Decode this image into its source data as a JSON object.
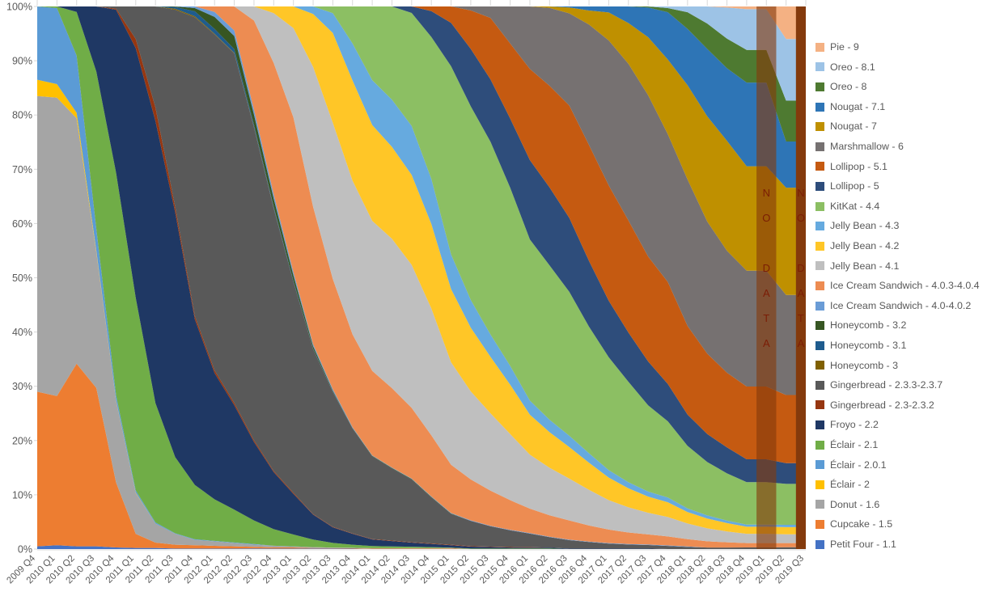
{
  "chart_data": {
    "type": "area",
    "title": "",
    "xlabel": "",
    "ylabel": "",
    "ylim": [
      0,
      100
    ],
    "y_ticks": [
      "0%",
      "10%",
      "20%",
      "30%",
      "40%",
      "50%",
      "60%",
      "70%",
      "80%",
      "90%",
      "100%"
    ],
    "stacking": "percent",
    "grid": false,
    "legend_position": "right",
    "categories": [
      "2009 Q4",
      "2010 Q1",
      "2010 Q2",
      "2010 Q3",
      "2010 Q4",
      "2011 Q1",
      "2011 Q2",
      "2011 Q3",
      "2011 Q4",
      "2012 Q1",
      "2012 Q2",
      "2012 Q3",
      "2012 Q4",
      "2013 Q1",
      "2013 Q2",
      "2013 Q3",
      "2013 Q4",
      "2014 Q1",
      "2014 Q2",
      "2014 Q3",
      "2014 Q4",
      "2015 Q1",
      "2015 Q2",
      "2015 Q3",
      "2015 Q4",
      "2016 Q1",
      "2016 Q2",
      "2016 Q3",
      "2016 Q4",
      "2017 Q1",
      "2017 Q2",
      "2017 Q3",
      "2017 Q4",
      "2018 Q1",
      "2018 Q2",
      "2018 Q3",
      "2018 Q4",
      "2019 Q1",
      "2019 Q2",
      "2019 Q3"
    ],
    "no_data_columns": [
      "2019 Q1",
      "2019 Q3"
    ],
    "no_data_label": "NO DATA",
    "no_data_color": "#843A0C",
    "series": [
      {
        "name": "Pie - 9",
        "color": "#F4B183",
        "values": [
          0,
          0,
          0,
          0,
          0,
          0,
          0,
          0,
          0,
          0,
          0,
          0,
          0,
          0,
          0,
          0,
          0,
          0,
          0,
          0,
          0,
          0,
          0,
          0,
          0,
          0,
          0,
          0,
          0,
          0,
          0,
          0,
          0,
          0,
          0,
          0.2,
          0.5,
          0,
          5.5,
          0
        ]
      },
      {
        "name": "Oreo - 8.1",
        "color": "#9DC3E6",
        "values": [
          0,
          0,
          0,
          0,
          0,
          0,
          0,
          0,
          0,
          0,
          0,
          0,
          0,
          0,
          0,
          0,
          0,
          0,
          0,
          0,
          0,
          0,
          0,
          0,
          0,
          0,
          0,
          0,
          0,
          0,
          0,
          0,
          0.3,
          1.1,
          3.3,
          6.0,
          7.5,
          0,
          10.4,
          0
        ]
      },
      {
        "name": "Oreo - 8",
        "color": "#4E7A31",
        "values": [
          0,
          0,
          0,
          0,
          0,
          0,
          0,
          0,
          0,
          0,
          0,
          0,
          0,
          0,
          0,
          0,
          0,
          0,
          0,
          0,
          0,
          0,
          0,
          0,
          0,
          0,
          0,
          0,
          0,
          0,
          0,
          0.2,
          0.8,
          3.2,
          4.9,
          5.7,
          6.0,
          0,
          6.9,
          0
        ]
      },
      {
        "name": "Nougat - 7.1",
        "color": "#2E75B6",
        "values": [
          0,
          0,
          0,
          0,
          0,
          0,
          0,
          0,
          0,
          0,
          0,
          0,
          0,
          0,
          0,
          0,
          0,
          0,
          0,
          0,
          0,
          0,
          0,
          0,
          0,
          0,
          0,
          0.2,
          0.8,
          1.2,
          3.3,
          5.9,
          9.0,
          10.8,
          13.0,
          14.0,
          15.4,
          0,
          7.8,
          0
        ]
      },
      {
        "name": "Nougat - 7",
        "color": "#BF9000",
        "values": [
          0,
          0,
          0,
          0,
          0,
          0,
          0,
          0,
          0,
          0,
          0,
          0,
          0,
          0,
          0,
          0,
          0,
          0,
          0,
          0,
          0,
          0,
          0,
          0,
          0,
          0,
          0.3,
          1.2,
          2.8,
          5.6,
          8.1,
          11.5,
          14.2,
          18.1,
          20.3,
          21.2,
          19.2,
          0,
          18.1,
          0
        ]
      },
      {
        "name": "Marshmallow - 6",
        "color": "#767171",
        "values": [
          0,
          0,
          0,
          0,
          0,
          0,
          0,
          0,
          0,
          0,
          0,
          0,
          0,
          0,
          0,
          0,
          0,
          0,
          0,
          0,
          0,
          0,
          0.8,
          2.3,
          7.5,
          13.3,
          16.4,
          18.7,
          24.0,
          29.0,
          31.2,
          32.0,
          28.1,
          28.1,
          25.5,
          23.5,
          21.3,
          0,
          16.9,
          0
        ]
      },
      {
        "name": "Lollipop - 5.1",
        "color": "#C55A11",
        "values": [
          0,
          0,
          0,
          0,
          0,
          0,
          0,
          0,
          0,
          0,
          0,
          0,
          0,
          0,
          0,
          0,
          0,
          0,
          0,
          0,
          1.0,
          3.4,
          7.8,
          12.4,
          15.2,
          19.4,
          21.4,
          22.8,
          23.1,
          23.1,
          22.3,
          20.8,
          19.4,
          17.0,
          15.5,
          14.4,
          13.4,
          0,
          11.5,
          0
        ]
      },
      {
        "name": "Lollipop - 5",
        "color": "#2E4D7B",
        "values": [
          0,
          0,
          0,
          0,
          0,
          0,
          0,
          0,
          0,
          0,
          0,
          0,
          0,
          0,
          0,
          0,
          0,
          0,
          0,
          1.4,
          5.5,
          9.0,
          11.6,
          12.6,
          14.0,
          16.9,
          16.4,
          15.0,
          13.1,
          11.3,
          9.8,
          8.7,
          7.1,
          6.0,
          5.4,
          5.0,
          4.2,
          0,
          3.5,
          0
        ]
      },
      {
        "name": "KitKat - 4.4",
        "color": "#8CBF63",
        "values": [
          0,
          0,
          0,
          0,
          0,
          0,
          0,
          0,
          0,
          0,
          0,
          0,
          0,
          0,
          0,
          1.4,
          8.5,
          16.9,
          20.9,
          24.5,
          30.2,
          39.1,
          39.2,
          38.9,
          36.1,
          34.3,
          32.5,
          29.2,
          25.2,
          22.6,
          20.0,
          17.1,
          14.5,
          12.0,
          10.3,
          9.1,
          7.8,
          0,
          6.9,
          0
        ]
      },
      {
        "name": "Jelly Bean - 4.3",
        "color": "#66AADF",
        "values": [
          0,
          0,
          0,
          0,
          0,
          0,
          0,
          0,
          0,
          0,
          0,
          0,
          0,
          0,
          1.5,
          4.2,
          8.5,
          10.3,
          10.6,
          10.6,
          9.6,
          7.2,
          5.6,
          4.5,
          3.8,
          3.0,
          2.6,
          2.3,
          1.9,
          1.5,
          1.2,
          1.0,
          0.9,
          0.7,
          0.6,
          0.5,
          0.4,
          0,
          0.4,
          0
        ]
      },
      {
        "name": "Jelly Bean - 4.2",
        "color": "#FFC627",
        "values": [
          0,
          0,
          0,
          0,
          0,
          0,
          0,
          0,
          0,
          0,
          0,
          0,
          1.2,
          4.0,
          10.6,
          19.0,
          23.0,
          22.0,
          20.6,
          19.5,
          18.0,
          15.2,
          12.9,
          11.4,
          10.0,
          8.5,
          7.5,
          6.4,
          5.4,
          4.5,
          3.8,
          3.2,
          2.8,
          2.2,
          1.9,
          1.6,
          1.3,
          0,
          1.2,
          0
        ]
      },
      {
        "name": "Jelly Bean - 4.1",
        "color": "#BFBFBF",
        "values": [
          0,
          0,
          0,
          0,
          0,
          0,
          0,
          0,
          0,
          0,
          0,
          2.5,
          9.0,
          16.5,
          28.0,
          33.0,
          35.3,
          34.4,
          33.5,
          31.0,
          27.0,
          21.3,
          17.8,
          15.6,
          13.4,
          11.5,
          10.0,
          8.5,
          7.1,
          5.9,
          5.0,
          4.3,
          3.7,
          3.0,
          2.5,
          2.1,
          1.7,
          0,
          1.5,
          0
        ]
      },
      {
        "name": "Ice Cream Sandwich - 4.0.3-4.0.4",
        "color": "#ED8C52",
        "values": [
          0,
          0,
          0,
          0,
          0,
          0,
          0,
          0,
          0,
          1.0,
          4.4,
          15.9,
          23.7,
          28.6,
          27.5,
          23.3,
          21.3,
          19.4,
          17.8,
          15.3,
          13.0,
          10.0,
          8.3,
          7.1,
          6.0,
          5.2,
          4.5,
          3.9,
          3.2,
          2.7,
          2.3,
          2.0,
          1.7,
          1.4,
          1.2,
          1.0,
          0.8,
          0,
          0.7,
          0
        ]
      },
      {
        "name": "Ice Cream Sandwich - 4.0-4.0.2",
        "color": "#6A9CD6",
        "values": [
          0,
          0,
          0,
          0,
          0,
          0,
          0,
          0,
          0.3,
          0.9,
          1.0,
          0.9,
          0.8,
          0.6,
          0.4,
          0.3,
          0.2,
          0.1,
          0.1,
          0.1,
          0.1,
          0.1,
          0.1,
          0.1,
          0.1,
          0.1,
          0.1,
          0.1,
          0.1,
          0.1,
          0.1,
          0.1,
          0.1,
          0.1,
          0,
          0,
          0,
          0,
          0,
          0
        ]
      },
      {
        "name": "Honeycomb - 3.2",
        "color": "#375623",
        "values": [
          0,
          0,
          0,
          0,
          0,
          0,
          0,
          0.1,
          0.6,
          2.2,
          2.4,
          1.8,
          1.4,
          1.0,
          0.5,
          0.2,
          0.1,
          0.1,
          0.1,
          0.1,
          0.1,
          0.1,
          0,
          0,
          0,
          0,
          0,
          0,
          0,
          0,
          0,
          0,
          0,
          0,
          0,
          0,
          0,
          0,
          0,
          0
        ]
      },
      {
        "name": "Honeycomb - 3.1",
        "color": "#1F5C8E",
        "values": [
          0,
          0,
          0,
          0,
          0,
          0,
          0,
          0.3,
          0.9,
          0.9,
          0.7,
          0.4,
          0.3,
          0.2,
          0.1,
          0.1,
          0,
          0,
          0,
          0,
          0,
          0,
          0,
          0,
          0,
          0,
          0,
          0,
          0,
          0,
          0,
          0,
          0,
          0,
          0,
          0,
          0,
          0,
          0,
          0
        ]
      },
      {
        "name": "Honeycomb - 3",
        "color": "#806000",
        "values": [
          0,
          0,
          0,
          0,
          0,
          0,
          0,
          0.2,
          0.2,
          0.1,
          0.1,
          0.1,
          0.1,
          0,
          0,
          0,
          0,
          0,
          0,
          0,
          0,
          0,
          0,
          0,
          0,
          0,
          0,
          0,
          0,
          0,
          0,
          0,
          0,
          0,
          0,
          0,
          0,
          0,
          0,
          0
        ]
      },
      {
        "name": "Gingerbread - 2.3.3-2.3.7",
        "color": "#595959",
        "values": [
          0,
          0,
          0,
          0,
          0.4,
          6.0,
          18.6,
          36.2,
          55.0,
          61.5,
          63.9,
          55.8,
          47.4,
          39.0,
          33.0,
          28.5,
          24.1,
          19.0,
          16.2,
          13.6,
          9.8,
          6.4,
          5.1,
          4.1,
          3.4,
          2.9,
          2.2,
          1.7,
          1.3,
          1.0,
          0.8,
          0.7,
          0.6,
          0.4,
          0.3,
          0.3,
          0.3,
          0,
          0.3,
          0
        ]
      },
      {
        "name": "Gingerbread - 2.3-2.3.2",
        "color": "#963610",
        "values": [
          0,
          0,
          0,
          0,
          0.2,
          1.7,
          2.5,
          1.0,
          0.6,
          0.5,
          0.4,
          0.3,
          0.2,
          0.2,
          0.1,
          0.1,
          0.1,
          0.1,
          0.1,
          0.1,
          0.1,
          0.1,
          0.1,
          0.1,
          0.1,
          0.1,
          0,
          0,
          0,
          0,
          0,
          0,
          0,
          0,
          0,
          0,
          0,
          0,
          0,
          0
        ]
      },
      {
        "name": "Froyo - 2.2",
        "color": "#1F3864",
        "values": [
          0,
          0,
          1.0,
          12.0,
          30.0,
          46.0,
          52.0,
          45.0,
          30.5,
          23.1,
          19.1,
          14.0,
          10.3,
          7.5,
          5.0,
          3.3,
          2.5,
          1.5,
          1.2,
          0.9,
          0.7,
          0.5,
          0.4,
          0.3,
          0.2,
          0.2,
          0.2,
          0.1,
          0.1,
          0.1,
          0.1,
          0.1,
          0,
          0,
          0,
          0,
          0,
          0,
          0,
          0
        ]
      },
      {
        "name": "Éclair - 2.1",
        "color": "#70AD47",
        "values": [
          0,
          0.3,
          8.0,
          29.0,
          41.0,
          35.5,
          22.0,
          14.0,
          10.0,
          7.6,
          6.0,
          4.2,
          3.0,
          2.2,
          1.5,
          1.0,
          0.7,
          0.5,
          0.4,
          0.3,
          0.2,
          0.1,
          0.1,
          0.1,
          0.1,
          0.1,
          0.1,
          0,
          0,
          0,
          0,
          0,
          0,
          0,
          0,
          0,
          0,
          0,
          0,
          0
        ]
      },
      {
        "name": "Éclair - 2.0.1",
        "color": "#5B9BD5",
        "values": [
          13.5,
          14.0,
          10.5,
          4.0,
          1.0,
          0.4,
          0.2,
          0.1,
          0.1,
          0.1,
          0.1,
          0.1,
          0,
          0,
          0,
          0,
          0,
          0,
          0,
          0,
          0,
          0,
          0,
          0,
          0,
          0,
          0,
          0,
          0,
          0,
          0,
          0,
          0,
          0,
          0,
          0,
          0,
          0,
          0,
          0
        ]
      },
      {
        "name": "Éclair - 2",
        "color": "#FFC000",
        "values": [
          3.0,
          2.5,
          1.0,
          0.3,
          0.1,
          0.1,
          0,
          0,
          0,
          0,
          0,
          0,
          0,
          0,
          0,
          0,
          0,
          0,
          0,
          0,
          0,
          0,
          0,
          0,
          0,
          0,
          0,
          0,
          0,
          0,
          0,
          0,
          0,
          0,
          0,
          0,
          0,
          0,
          0,
          0
        ]
      },
      {
        "name": "Donut - 1.6",
        "color": "#A5A5A5",
        "values": [
          54.5,
          55.0,
          45.0,
          25.0,
          15.0,
          7.5,
          3.5,
          2.0,
          1.0,
          0.8,
          0.6,
          0.4,
          0.3,
          0.2,
          0.2,
          0.1,
          0.1,
          0.1,
          0.1,
          0.1,
          0.1,
          0.1,
          0,
          0,
          0,
          0,
          0,
          0,
          0,
          0,
          0,
          0,
          0,
          0,
          0,
          0,
          0,
          0,
          0,
          0
        ]
      },
      {
        "name": "Cupcake - 1.5",
        "color": "#ED7D31",
        "values": [
          28.5,
          27.5,
          33.5,
          29.2,
          12.0,
          2.6,
          1.0,
          0.7,
          0.6,
          0.5,
          0.4,
          0.3,
          0.2,
          0.2,
          0.1,
          0.1,
          0.1,
          0.1,
          0.1,
          0.1,
          0.1,
          0.1,
          0,
          0,
          0,
          0,
          0,
          0,
          0,
          0,
          0,
          0,
          0,
          0,
          0,
          0,
          0,
          0,
          0,
          0
        ]
      },
      {
        "name": "Petit Four - 1.1",
        "color": "#4472C4",
        "values": [
          0.5,
          0.7,
          0.5,
          0.5,
          0.3,
          0.2,
          0.2,
          0.1,
          0.1,
          0.1,
          0.1,
          0.1,
          0.1,
          0.1,
          0.1,
          0.1,
          0.1,
          0,
          0,
          0,
          0,
          0,
          0,
          0,
          0,
          0,
          0,
          0,
          0,
          0,
          0,
          0,
          0,
          0,
          0,
          0,
          0,
          0,
          0,
          0
        ]
      }
    ]
  },
  "axes": {
    "y_ticks": [
      "100%",
      "90%",
      "80%",
      "70%",
      "60%",
      "50%",
      "40%",
      "30%",
      "20%",
      "10%",
      "0%"
    ]
  }
}
